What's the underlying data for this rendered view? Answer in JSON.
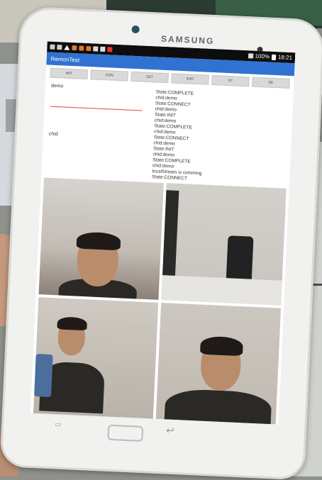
{
  "device": {
    "brand": "SAMSUNG"
  },
  "status_bar": {
    "battery": "100%",
    "time": "18:21"
  },
  "app": {
    "title": "RemonTest"
  },
  "buttons": [
    "INIT",
    "CON",
    "SET",
    "IDAT",
    "DT",
    "DE"
  ],
  "fields": {
    "demo_label": "demo",
    "chid_label": "chid"
  },
  "log": [
    "State:COMPLETE",
    "chid:demo",
    "State:CONNECT",
    "chid:demo",
    "State:INIT",
    "chid:demo",
    "State:COMPLETE",
    "chid:demo",
    "State:CONNECT",
    "chid:demo",
    "State:INIT",
    "chid:demo",
    "State:COMPLETE",
    "chid:demo",
    "localStream is comming",
    "State:CONNECT"
  ],
  "video_tiles": 4
}
